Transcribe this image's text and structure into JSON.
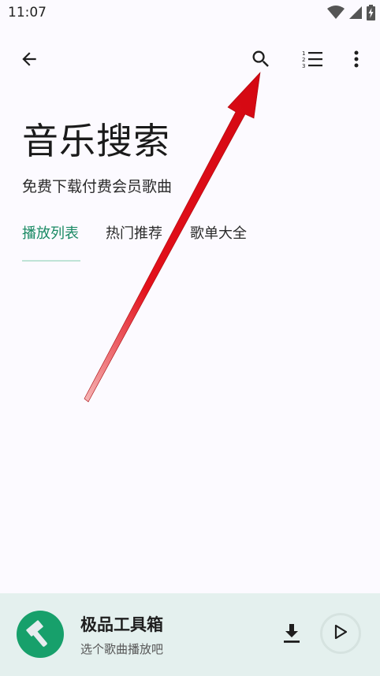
{
  "status_bar": {
    "time": "11:07",
    "icons": [
      "wifi-icon",
      "cellular-signal-icon",
      "battery-charging-icon"
    ]
  },
  "toolbar": {
    "back_icon": "arrow-back-icon",
    "search_icon": "search-icon",
    "list_icon": "numbered-list-icon",
    "more_icon": "more-vert-icon"
  },
  "header": {
    "title": "音乐搜索",
    "subtitle": "免费下载付费会员歌曲"
  },
  "tabs": [
    {
      "label": "播放列表",
      "active": true
    },
    {
      "label": "热门推荐",
      "active": false
    },
    {
      "label": "歌单大全",
      "active": false
    }
  ],
  "player": {
    "title": "极品工具箱",
    "subtitle": "选个歌曲播放吧",
    "art_icon": "hammer-icon",
    "download_icon": "download-icon",
    "play_icon": "play-icon"
  },
  "colors": {
    "accent": "#1a8a64",
    "tab_indicator": "#bfe3d7",
    "player_background": "#e4f0ee",
    "art_background": "#17a06b",
    "annotation_arrow": "#e3101a",
    "page_background": "#fcfaff"
  }
}
